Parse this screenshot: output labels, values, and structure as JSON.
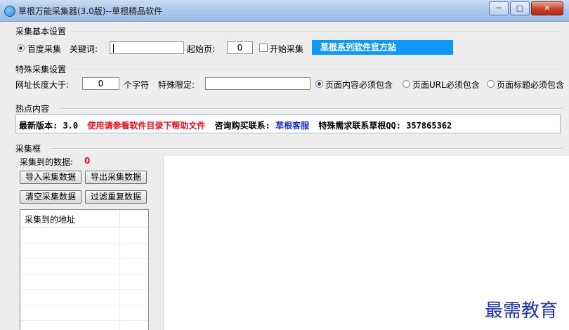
{
  "window": {
    "title": "草根万能采集器(3.0版)--草根精品软件",
    "buttons": {
      "minimize": "─",
      "maximize": "□",
      "close": "✕"
    }
  },
  "basic": {
    "title": "采集基本设置",
    "radio_label": "百度采集",
    "keyword_label": "关键词:",
    "keyword_value": "",
    "start_page_label": "起始页:",
    "start_page_value": "0",
    "start_collect_label": "开始采集",
    "site_link": "草根系列软件官方站"
  },
  "special": {
    "title": "特殊采集设置",
    "url_length_label": "网址长度大于:",
    "url_length_value": "0",
    "chars_suffix": "个字符",
    "limit_label": "特殊限定:",
    "limit_value": "",
    "options": [
      "页面内容必须包含",
      "页面URL必须包含",
      "页面标题必须包含"
    ]
  },
  "hot": {
    "title": "热点内容",
    "version_text": "最新版本: 3.0",
    "help_text": "使用请参看软件目录下帮助文件",
    "contact_label": "咨询购买联系:",
    "contact_name": "草根客服",
    "qq_text": "特殊需求联系草根QQ: 357865362"
  },
  "collect": {
    "title": "采集框",
    "count_label": "采集到的数据:",
    "count_value": "0",
    "buttons": {
      "import": "导入采集数据",
      "export": "导出采集数据",
      "clear": "清空采集数据",
      "dedupe": "过滤重复数据"
    },
    "list_header": "采集到的地址"
  },
  "watermark": "最需教育",
  "colors": {
    "link_bg": "#0d97f6",
    "red_text": "#e8101a",
    "blue_text": "#1a2fd6"
  }
}
